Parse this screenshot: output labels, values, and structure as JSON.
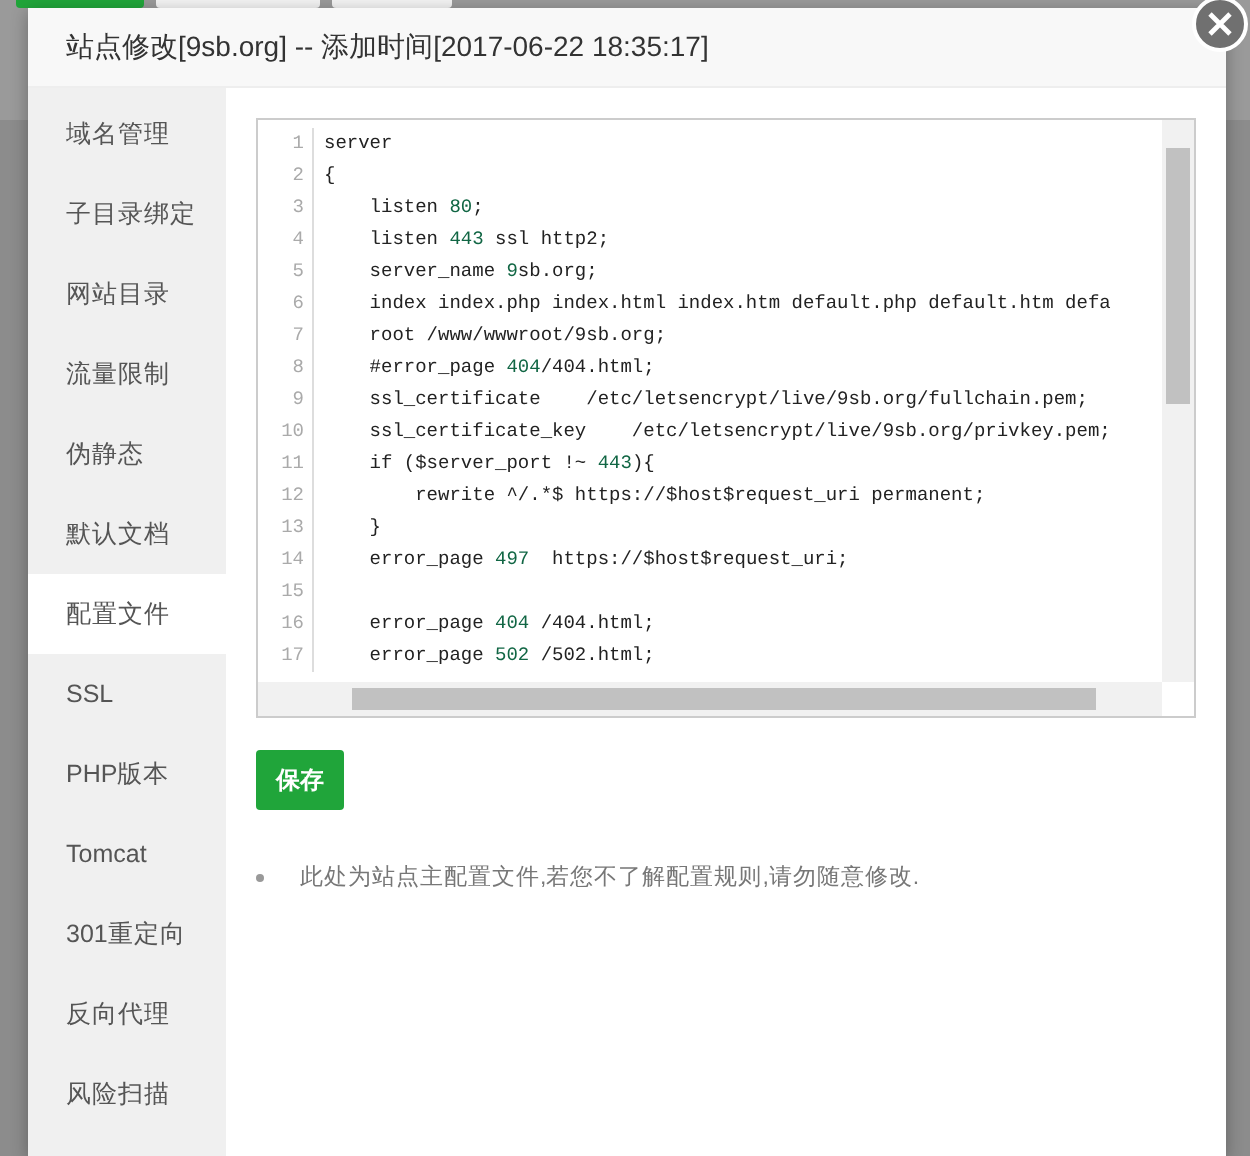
{
  "dialog": {
    "title": "站点修改[9sb.org] -- 添加时间[2017-06-22 18:35:17]"
  },
  "sidebar": {
    "items": [
      {
        "label": "域名管理",
        "selected": false
      },
      {
        "label": "子目录绑定",
        "selected": false
      },
      {
        "label": "网站目录",
        "selected": false
      },
      {
        "label": "流量限制",
        "selected": false
      },
      {
        "label": "伪静态",
        "selected": false
      },
      {
        "label": "默认文档",
        "selected": false
      },
      {
        "label": "配置文件",
        "selected": true
      },
      {
        "label": "SSL",
        "selected": false
      },
      {
        "label": "PHP版本",
        "selected": false
      },
      {
        "label": "Tomcat",
        "selected": false
      },
      {
        "label": "301重定向",
        "selected": false
      },
      {
        "label": "反向代理",
        "selected": false
      },
      {
        "label": "风险扫描",
        "selected": false
      }
    ]
  },
  "editor": {
    "lines": [
      {
        "number": "1",
        "parts": [
          {
            "kind": "text",
            "text": "server"
          }
        ]
      },
      {
        "number": "2",
        "parts": [
          {
            "kind": "text",
            "text": "{"
          }
        ]
      },
      {
        "number": "3",
        "parts": [
          {
            "kind": "text",
            "text": "    listen "
          },
          {
            "kind": "number",
            "text": "80"
          },
          {
            "kind": "text",
            "text": ";"
          }
        ]
      },
      {
        "number": "4",
        "parts": [
          {
            "kind": "text",
            "text": "    listen "
          },
          {
            "kind": "number",
            "text": "443"
          },
          {
            "kind": "text",
            "text": " ssl http2;"
          }
        ]
      },
      {
        "number": "5",
        "parts": [
          {
            "kind": "text",
            "text": "    server_name "
          },
          {
            "kind": "number",
            "text": "9"
          },
          {
            "kind": "text",
            "text": "sb.org;"
          }
        ]
      },
      {
        "number": "6",
        "parts": [
          {
            "kind": "text",
            "text": "    index index.php index.html index.htm default.php default.htm defa"
          }
        ]
      },
      {
        "number": "7",
        "parts": [
          {
            "kind": "text",
            "text": "    root /www/wwwroot/9sb.org;"
          }
        ]
      },
      {
        "number": "8",
        "parts": [
          {
            "kind": "text",
            "text": "    #error_page "
          },
          {
            "kind": "number",
            "text": "404"
          },
          {
            "kind": "text",
            "text": "/404.html;"
          }
        ]
      },
      {
        "number": "9",
        "parts": [
          {
            "kind": "text",
            "text": "    ssl_certificate    /etc/letsencrypt/live/9sb.org/fullchain.pem;"
          }
        ]
      },
      {
        "number": "10",
        "parts": [
          {
            "kind": "text",
            "text": "    ssl_certificate_key    /etc/letsencrypt/live/9sb.org/privkey.pem;"
          }
        ]
      },
      {
        "number": "11",
        "parts": [
          {
            "kind": "text",
            "text": "    if ($server_port !~ "
          },
          {
            "kind": "number",
            "text": "443"
          },
          {
            "kind": "text",
            "text": "){"
          }
        ]
      },
      {
        "number": "12",
        "parts": [
          {
            "kind": "text",
            "text": "        rewrite ^/.*$ https://$host$request_uri permanent;"
          }
        ]
      },
      {
        "number": "13",
        "parts": [
          {
            "kind": "text",
            "text": "    }"
          }
        ]
      },
      {
        "number": "14",
        "parts": [
          {
            "kind": "text",
            "text": "    error_page "
          },
          {
            "kind": "number",
            "text": "497"
          },
          {
            "kind": "text",
            "text": "  https://$host$request_uri;"
          }
        ]
      },
      {
        "number": "15"
      },
      {
        "number": "16",
        "parts": [
          {
            "kind": "text",
            "text": "    error_page "
          },
          {
            "kind": "number",
            "text": "404"
          },
          {
            "kind": "text",
            "text": " /404.html;"
          }
        ]
      },
      {
        "number": "17",
        "parts": [
          {
            "kind": "text",
            "text": "    error_page "
          },
          {
            "kind": "number",
            "text": "502"
          },
          {
            "kind": "text",
            "text": " /502.html;"
          }
        ]
      }
    ]
  },
  "save_button": "保存",
  "notes": [
    "此处为站点主配置文件,若您不了解配置规则,请勿随意修改."
  ]
}
